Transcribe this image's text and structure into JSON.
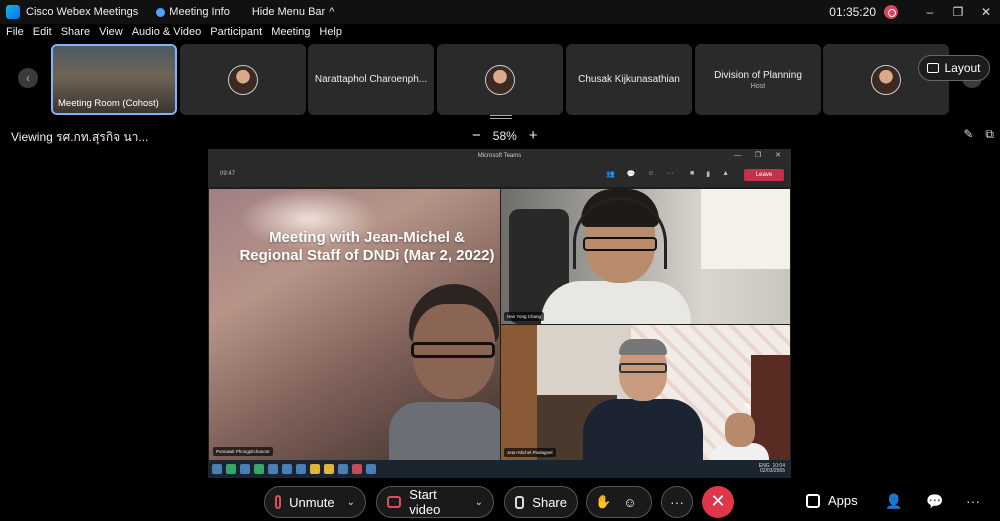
{
  "titlebar": {
    "app_name": "Cisco Webex Meetings",
    "meeting_info": "Meeting Info",
    "hide_menu_bar": "Hide Menu Bar",
    "hide_menu_bar_icon": "^",
    "time": "01:35:20",
    "minimize": "–",
    "maximize": "❐",
    "close": "✕"
  },
  "menu": [
    "File",
    "Edit",
    "Share",
    "View",
    "Audio & Video",
    "Participant",
    "Meeting",
    "Help"
  ],
  "strip": {
    "prev": "‹",
    "next": "›",
    "thumbs": [
      {
        "label": "Meeting Room (Cohost)",
        "sub": ""
      },
      {
        "label": "",
        "sub": ""
      },
      {
        "label": "Narattaphol Charoenph...",
        "sub": ""
      },
      {
        "label": "",
        "sub": ""
      },
      {
        "label": "Chusak Kijkunasathian",
        "sub": ""
      },
      {
        "label": "Division of Planning",
        "sub": "Host"
      },
      {
        "label": "",
        "sub": ""
      }
    ],
    "layout_label": "Layout"
  },
  "viewbar": {
    "viewing": "Viewing รศ.กท.สุรกิจ นา...",
    "zoom_out": "−",
    "zoom": "58%",
    "zoom_in": "+"
  },
  "shared_screen": {
    "window_title": "Microsoft Teams",
    "window_controls": "— ❐ ✕",
    "timer": "09:47",
    "leave": "Leave",
    "slide_text": "Meeting with Jean-Michel & Regional Staff of DNDi (Mar 2, 2022)",
    "tiles": [
      {
        "name": "Punnawit Phongpitchanont"
      },
      {
        "name": "Han Yong Chang"
      },
      {
        "name": "Jean-Michel Piedagnel"
      }
    ],
    "taskbar_lang": "ENG",
    "taskbar_time": "10:04",
    "taskbar_date": "02/03/2565"
  },
  "controls": {
    "unmute": "Unmute",
    "start_video": "Start video",
    "share": "Share",
    "more": "···",
    "leave": "✕",
    "apps": "Apps",
    "caret": "⌄"
  },
  "colors": {
    "accent_blue": "#7db4ff",
    "leave_red": "#e0364a",
    "muted_red": "#e04d5e",
    "teams_leave": "#c4314b"
  }
}
